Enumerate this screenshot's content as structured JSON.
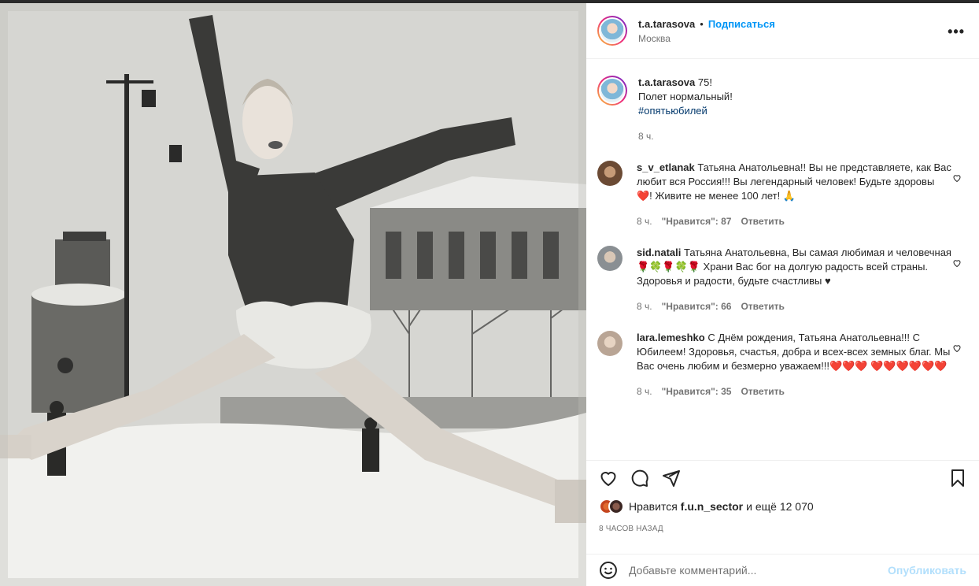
{
  "post": {
    "username": "t.a.tarasova",
    "follow_label": "Подписаться",
    "location": "Москва",
    "more_label": "•••"
  },
  "caption": {
    "username": "t.a.tarasova",
    "text_line1": "75!",
    "text_line2": "Полет нормальный!",
    "hashtag": "#опятьюбилей",
    "time": "8 ч."
  },
  "comments": [
    {
      "username": "s_v_etlanak",
      "text": "Татьяна Анатольевна!! Вы не представляете, как Вас любит вся Россия!!! Вы легендарный человек! Будьте здоровы ❤️! Живите не менее 100 лет! 🙏",
      "time": "8 ч.",
      "likes": "\"Нравится\": 87",
      "reply": "Ответить"
    },
    {
      "username": "sid.natali",
      "text": "Татьяна Анатольевна, Вы самая любимая и человечная🌹🍀🌹🍀🌹 Храни Вас бог на долгую радость всей страны.",
      "text2": "Здоровья и радости, будьте счастливы ♥",
      "time": "8 ч.",
      "likes": "\"Нравится\": 66",
      "reply": "Ответить"
    },
    {
      "username": "lara.lemeshko",
      "text": "С Днём рождения, Татьяна Анатольевна!!! С Юбилеем! Здоровья, счастья, добра и всех-всех земных благ. Мы Вас очень любим и безмерно уважаем!!!❤️❤️❤️ ❤️❤️❤️❤️❤️❤️",
      "time": "8 ч.",
      "likes": "\"Нравится\": 35",
      "reply": "Ответить"
    }
  ],
  "likes_bar": {
    "prefix": "Нравится",
    "liker": "f.u.n_sector",
    "suffix": "и ещё 12 070"
  },
  "time_ago": "8 ЧАСОВ НАЗАД",
  "add_comment": {
    "placeholder": "Добавьте комментарий...",
    "publish": "Опубликовать"
  },
  "icons": [
    "heart-icon",
    "comment-icon",
    "share-icon",
    "bookmark-icon",
    "emoji-icon",
    "more-icon"
  ]
}
